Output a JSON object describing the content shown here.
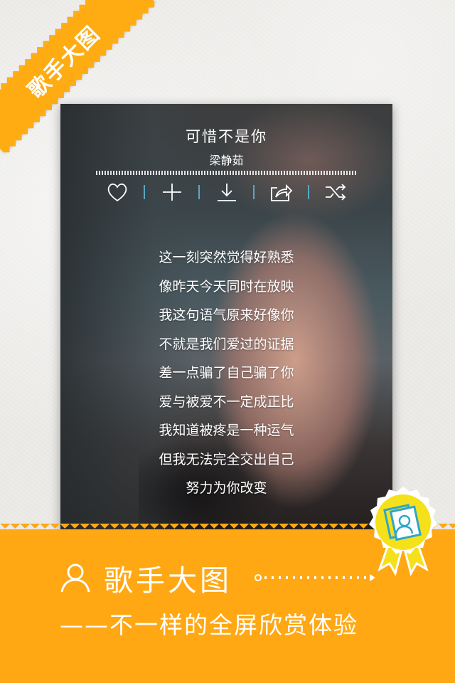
{
  "corner_ribbon": {
    "label": "歌手大图"
  },
  "player": {
    "title": "可惜不是你",
    "artist": "梁静茹",
    "actions": [
      {
        "name": "like",
        "icon": "heart-icon"
      },
      {
        "name": "add",
        "icon": "plus-icon"
      },
      {
        "name": "download",
        "icon": "download-icon"
      },
      {
        "name": "share",
        "icon": "share-icon"
      },
      {
        "name": "shuffle",
        "icon": "shuffle-icon"
      }
    ],
    "lyrics": [
      "这一刻突然觉得好熟悉",
      "像昨天今天同时在放映",
      "我这句语气原来好像你",
      "不就是我们爱过的证据",
      "差一点骗了自己骗了你",
      "爱与被爱不一定成正比",
      "我知道被疼是一种运气",
      "但我无法完全交出自己",
      "努力为你改变"
    ]
  },
  "banner": {
    "title": "歌手大图",
    "subtitle": "——不一样的全屏欣赏体验",
    "person_icon": "person-icon",
    "badge_icon": "award-badge-icon"
  },
  "colors": {
    "accent": "#ffa814",
    "separator": "#5aa7c4",
    "badge_yellow": "#f4e11c"
  }
}
